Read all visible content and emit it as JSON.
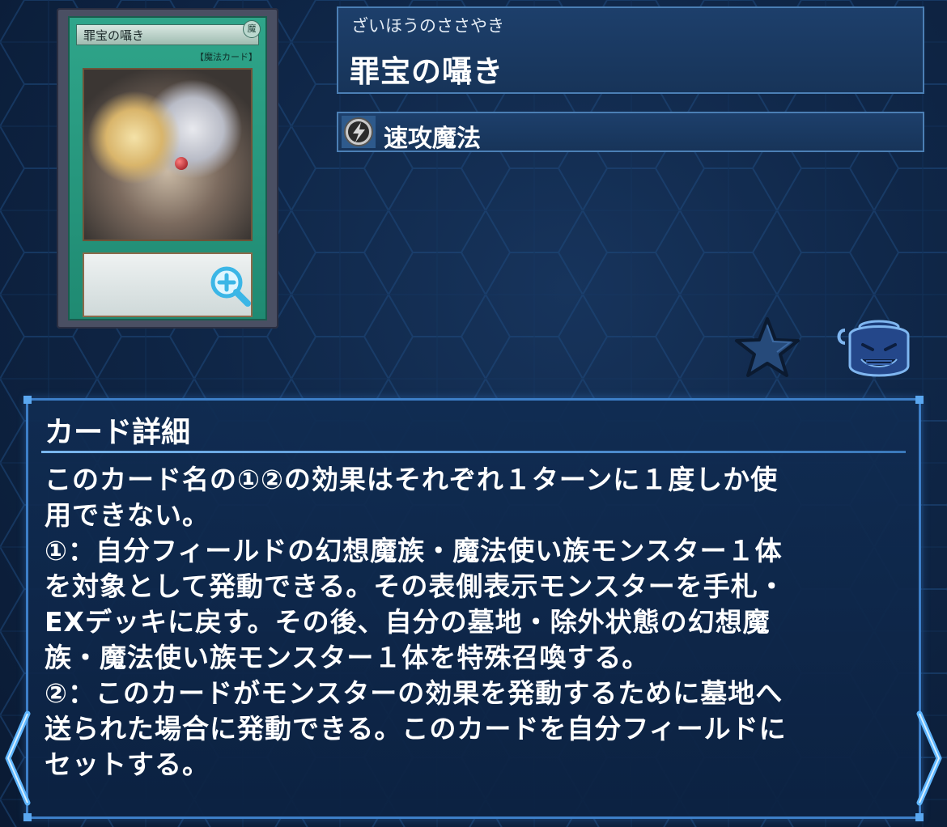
{
  "card": {
    "art_name": "罪宝の囁き",
    "art_attribute": "魔",
    "art_type_line": "【魔法カード】",
    "ruby": "ざいほうのささやき",
    "name": "罪宝の囁き",
    "spell_type": "速攻魔法",
    "spell_type_icon": "quick-play-icon"
  },
  "actions": {
    "zoom_icon": "zoom-in-icon",
    "favorite_icon": "star-icon",
    "pot_icon": "pot-of-greed-icon"
  },
  "details": {
    "title": "カード詳細",
    "text": "このカード名の①②の効果はそれぞれ１ターンに１度しか使\n用できない。\n①：自分フィールドの幻想魔族・魔法使い族モンスター１体\nを対象として発動できる。その表側表示モンスターを手札・\nEXデッキに戻す。その後、自分の墓地・除外状態の幻想魔\n族・魔法使い族モンスター１体を特殊召喚する。\n②：このカードがモンスターの効果を発動するために墓地へ\n送られた場合に発動できる。このカードを自分フィールドに\nセットする。"
  },
  "navigation": {
    "prev_icon": "chevron-left-icon",
    "next_icon": "chevron-right-icon"
  },
  "colors": {
    "panel_border": "#4b7fb5",
    "detail_border": "#3d7fc8",
    "background": "#0f2647"
  }
}
